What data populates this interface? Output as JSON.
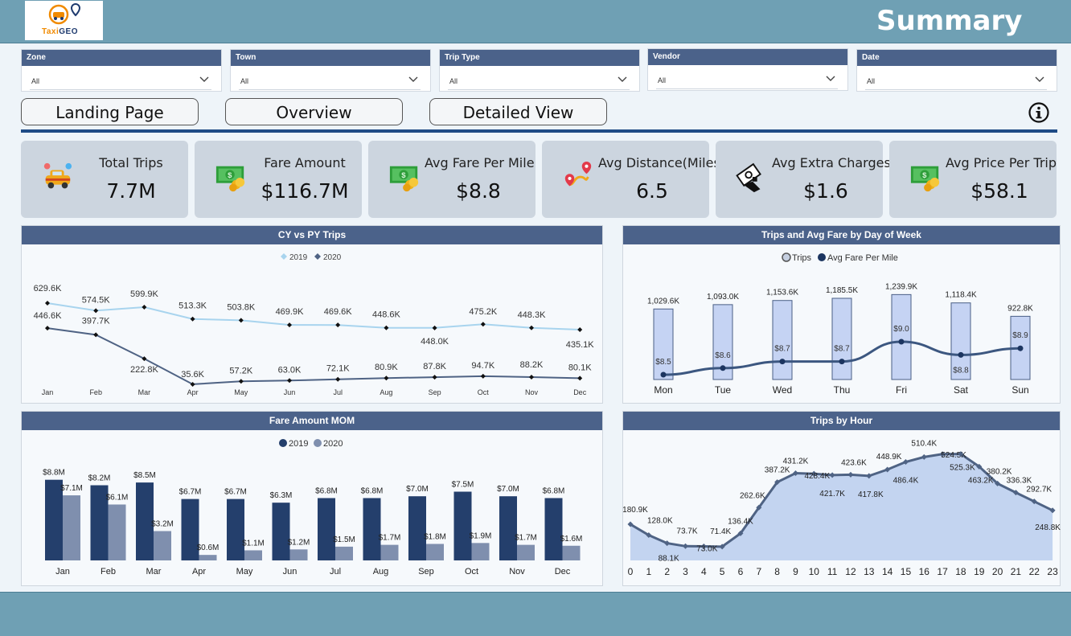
{
  "header": {
    "logo_text_a": "Taxi",
    "logo_text_b": "GEO",
    "title": "Summary"
  },
  "filters": [
    {
      "label": "Zone",
      "value": "All"
    },
    {
      "label": "Town",
      "value": "All"
    },
    {
      "label": "Trip Type",
      "value": "All"
    },
    {
      "label": "Vendor",
      "value": "All"
    },
    {
      "label": "Date",
      "value": "All"
    }
  ],
  "nav": {
    "landing": "Landing Page",
    "overview": "Overview",
    "detailed": "Detailed View",
    "info_icon": "info-icon"
  },
  "kpis": [
    {
      "label": "Total Trips",
      "value": "7.7M",
      "icon": "taxi-icon"
    },
    {
      "label": "Fare Amount",
      "value": "$116.7M",
      "icon": "money-icon"
    },
    {
      "label": "Avg Fare Per Mile",
      "value": "$8.8",
      "icon": "money-icon"
    },
    {
      "label": "Avg Distance(Miles)",
      "value": "6.5",
      "icon": "route-icon"
    },
    {
      "label": "Avg Extra Charges",
      "value": "$1.6",
      "icon": "cash-hand-icon"
    },
    {
      "label": "Avg Price Per Trip",
      "value": "$58.1",
      "icon": "money-icon"
    }
  ],
  "colors": {
    "header_bar": "#6fa0b4",
    "panel_head": "#4b628a",
    "dark_series": "#243f6c",
    "light_series": "#7f8fae",
    "cy_line": "#a8d4ee",
    "py_line": "#4f6384",
    "fill_area": "#c3d4f0",
    "bar_fill": "#c5d3f3"
  },
  "chart_data": [
    {
      "type": "line",
      "title": "CY vs PY Trips",
      "categories": [
        "Jan",
        "Feb",
        "Mar",
        "Apr",
        "May",
        "Jun",
        "Jul",
        "Aug",
        "Sep",
        "Oct",
        "Nov",
        "Dec"
      ],
      "series": [
        {
          "name": "2019",
          "values": [
            629.6,
            574.5,
            599.9,
            513.3,
            503.8,
            469.9,
            469.6,
            448.6,
            448.0,
            475.2,
            448.3,
            435.1
          ],
          "labels": [
            "629.6K",
            "574.5K",
            "599.9K",
            "513.3K",
            "503.8K",
            "469.9K",
            "469.6K",
            "448.6K",
            "448.0K",
            "475.2K",
            "448.3K",
            "435.1K"
          ]
        },
        {
          "name": "2020",
          "values": [
            446.6,
            397.7,
            222.8,
            35.6,
            57.2,
            63.0,
            72.1,
            80.9,
            87.8,
            94.7,
            88.2,
            80.1
          ],
          "labels": [
            "446.6K",
            "397.7K",
            "222.8K",
            "35.6K",
            "57.2K",
            "63.0K",
            "72.1K",
            "80.9K",
            "87.8K",
            "94.7K",
            "88.2K",
            "80.1K"
          ]
        }
      ],
      "legend": "top-center"
    },
    {
      "type": "bar",
      "title": "Trips and Avg Fare by Day of Week",
      "categories": [
        "Mon",
        "Tue",
        "Wed",
        "Thu",
        "Fri",
        "Sat",
        "Sun"
      ],
      "series": [
        {
          "name": "Trips",
          "values": [
            1029.6,
            1093.0,
            1153.6,
            1185.5,
            1239.9,
            1118.4,
            922.8
          ],
          "labels": [
            "1,029.6K",
            "1,093.0K",
            "1,153.6K",
            "1,185.5K",
            "1,239.9K",
            "1,118.4K",
            "922.8K"
          ]
        },
        {
          "name": "Avg Fare Per Mile",
          "values": [
            8.5,
            8.6,
            8.7,
            8.7,
            9.0,
            8.8,
            8.9
          ],
          "labels": [
            "$8.5",
            "$8.6",
            "$8.7",
            "$8.7",
            "$9.0",
            "$8.8",
            "$8.9"
          ]
        }
      ],
      "legend": "top-center"
    },
    {
      "type": "bar",
      "title": "Fare Amount MOM",
      "categories": [
        "Jan",
        "Feb",
        "Mar",
        "Apr",
        "May",
        "Jun",
        "Jul",
        "Aug",
        "Sep",
        "Oct",
        "Nov",
        "Dec"
      ],
      "series": [
        {
          "name": "2019",
          "values": [
            8.8,
            8.2,
            8.5,
            6.7,
            6.7,
            6.3,
            6.8,
            6.8,
            7.0,
            7.5,
            7.0,
            6.8
          ],
          "labels": [
            "$8.8M",
            "$8.2M",
            "$8.5M",
            "$6.7M",
            "$6.7M",
            "$6.3M",
            "$6.8M",
            "$6.8M",
            "$7.0M",
            "$7.5M",
            "$7.0M",
            "$6.8M"
          ]
        },
        {
          "name": "2020",
          "values": [
            7.1,
            6.1,
            3.2,
            0.6,
            1.1,
            1.2,
            1.5,
            1.7,
            1.8,
            1.9,
            1.7,
            1.6
          ],
          "labels": [
            "$7.1M",
            "$6.1M",
            "$3.2M",
            "$0.6M",
            "$1.1M",
            "$1.2M",
            "$1.5M",
            "$1.7M",
            "$1.8M",
            "$1.9M",
            "$1.7M",
            "$1.6M"
          ]
        }
      ],
      "legend": "top-center"
    },
    {
      "type": "area",
      "title": "Trips by Hour",
      "x": [
        "0",
        "1",
        "2",
        "3",
        "4",
        "5",
        "6",
        "7",
        "8",
        "9",
        "10",
        "11",
        "12",
        "13",
        "14",
        "15",
        "16",
        "17",
        "18",
        "19",
        "20",
        "21",
        "22",
        "23"
      ],
      "values": [
        180.9,
        128.0,
        88.1,
        73.7,
        73.0,
        71.4,
        136.4,
        262.6,
        387.2,
        431.2,
        428.4,
        421.7,
        423.6,
        417.8,
        448.9,
        486.4,
        510.4,
        524.5,
        525.3,
        463.2,
        380.2,
        336.3,
        292.7,
        248.8
      ],
      "labels": [
        "180.9K",
        "128.0K",
        "88.1K",
        "73.7K",
        "73.0K",
        "71.4K",
        "136.4K",
        "262.6K",
        "387.2K",
        "431.2K",
        "428.4K",
        "421.7K",
        "423.6K",
        "417.8K",
        "448.9K",
        "486.4K",
        "510.4K",
        "524.5K",
        "525.3K",
        "463.2K",
        "380.2K",
        "336.3K",
        "292.7K",
        "248.8K"
      ]
    }
  ]
}
